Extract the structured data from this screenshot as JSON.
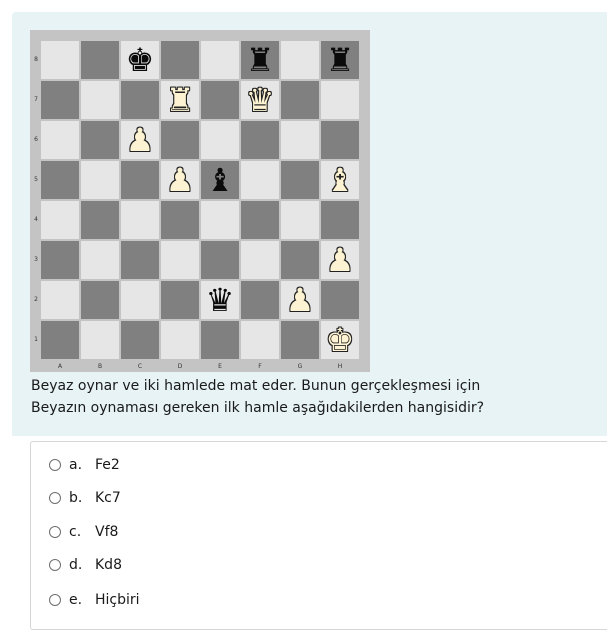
{
  "board": {
    "files": [
      "A",
      "B",
      "C",
      "D",
      "E",
      "F",
      "G",
      "H"
    ],
    "ranks": [
      "8",
      "7",
      "6",
      "5",
      "4",
      "3",
      "2",
      "1"
    ],
    "pieces": [
      {
        "square": "c8",
        "color": "black",
        "type": "king",
        "glyph": "♚"
      },
      {
        "square": "f8",
        "color": "black",
        "type": "rook",
        "glyph": "♜"
      },
      {
        "square": "h8",
        "color": "black",
        "type": "rook",
        "glyph": "♜"
      },
      {
        "square": "d7",
        "color": "white",
        "type": "rook",
        "glyph": "♜"
      },
      {
        "square": "f7",
        "color": "white",
        "type": "queen",
        "glyph": "♛"
      },
      {
        "square": "c6",
        "color": "white",
        "type": "pawn",
        "glyph": "♟"
      },
      {
        "square": "d5",
        "color": "white",
        "type": "pawn",
        "glyph": "♟"
      },
      {
        "square": "e5",
        "color": "black",
        "type": "bishop",
        "glyph": "♝"
      },
      {
        "square": "h5",
        "color": "white",
        "type": "bishop",
        "glyph": "♝"
      },
      {
        "square": "h3",
        "color": "white",
        "type": "pawn",
        "glyph": "♟"
      },
      {
        "square": "e2",
        "color": "black",
        "type": "queen",
        "glyph": "♛"
      },
      {
        "square": "g2",
        "color": "white",
        "type": "pawn",
        "glyph": "♟"
      },
      {
        "square": "h1",
        "color": "white",
        "type": "king",
        "glyph": "♚"
      }
    ]
  },
  "question": {
    "line1": "Beyaz oynar ve iki hamlede mat eder. Bunun gerçekleşmesi için",
    "line2": "Beyazın oynaması gereken ilk hamle aşağıdakilerden hangisidir?"
  },
  "options": [
    {
      "letter": "a.",
      "text": "Fe2"
    },
    {
      "letter": "b.",
      "text": "Kc7"
    },
    {
      "letter": "c.",
      "text": "Vf8"
    },
    {
      "letter": "d.",
      "text": "Kd8"
    },
    {
      "letter": "e.",
      "text": "Hiçbiri"
    }
  ],
  "colors": {
    "card_background": "#e7f3f5",
    "light_square": "#e6e6e6",
    "dark_square": "#808080"
  }
}
